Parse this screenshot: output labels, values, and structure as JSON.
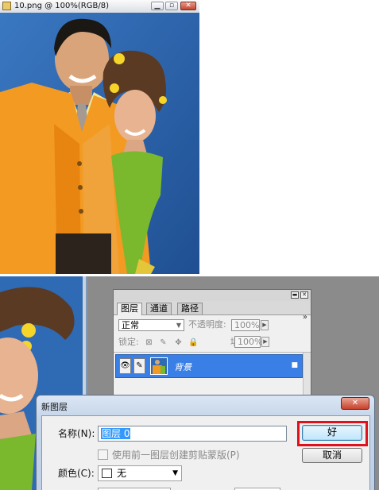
{
  "document_window": {
    "title": "10.png @ 100%(RGB/8)",
    "controls": [
      "minimize-icon",
      "restore-icon",
      "close-icon"
    ]
  },
  "layers_panel": {
    "menu_icon": "»",
    "tabs": [
      {
        "label": "图层",
        "active": true
      },
      {
        "label": "通道",
        "active": false
      },
      {
        "label": "路径",
        "active": false
      }
    ],
    "blend_mode": "正常",
    "opacity_label": "不透明度:",
    "opacity_value": "100%",
    "lock_label": "锁定:",
    "fill_label": "填充:",
    "fill_value": "100%",
    "layer": {
      "name": "背景",
      "visible": true,
      "locked": true
    }
  },
  "new_layer_dialog": {
    "title": "新图层",
    "name_label": "名称(N):",
    "name_value": "图层 0",
    "clip_label": "使用前一图层创建剪贴蒙版(P)",
    "clip_checked": false,
    "color_label": "颜色(C):",
    "color_value": "无",
    "ok_label": "好",
    "cancel_label": "取消",
    "highlight_color": "#e0101c"
  }
}
